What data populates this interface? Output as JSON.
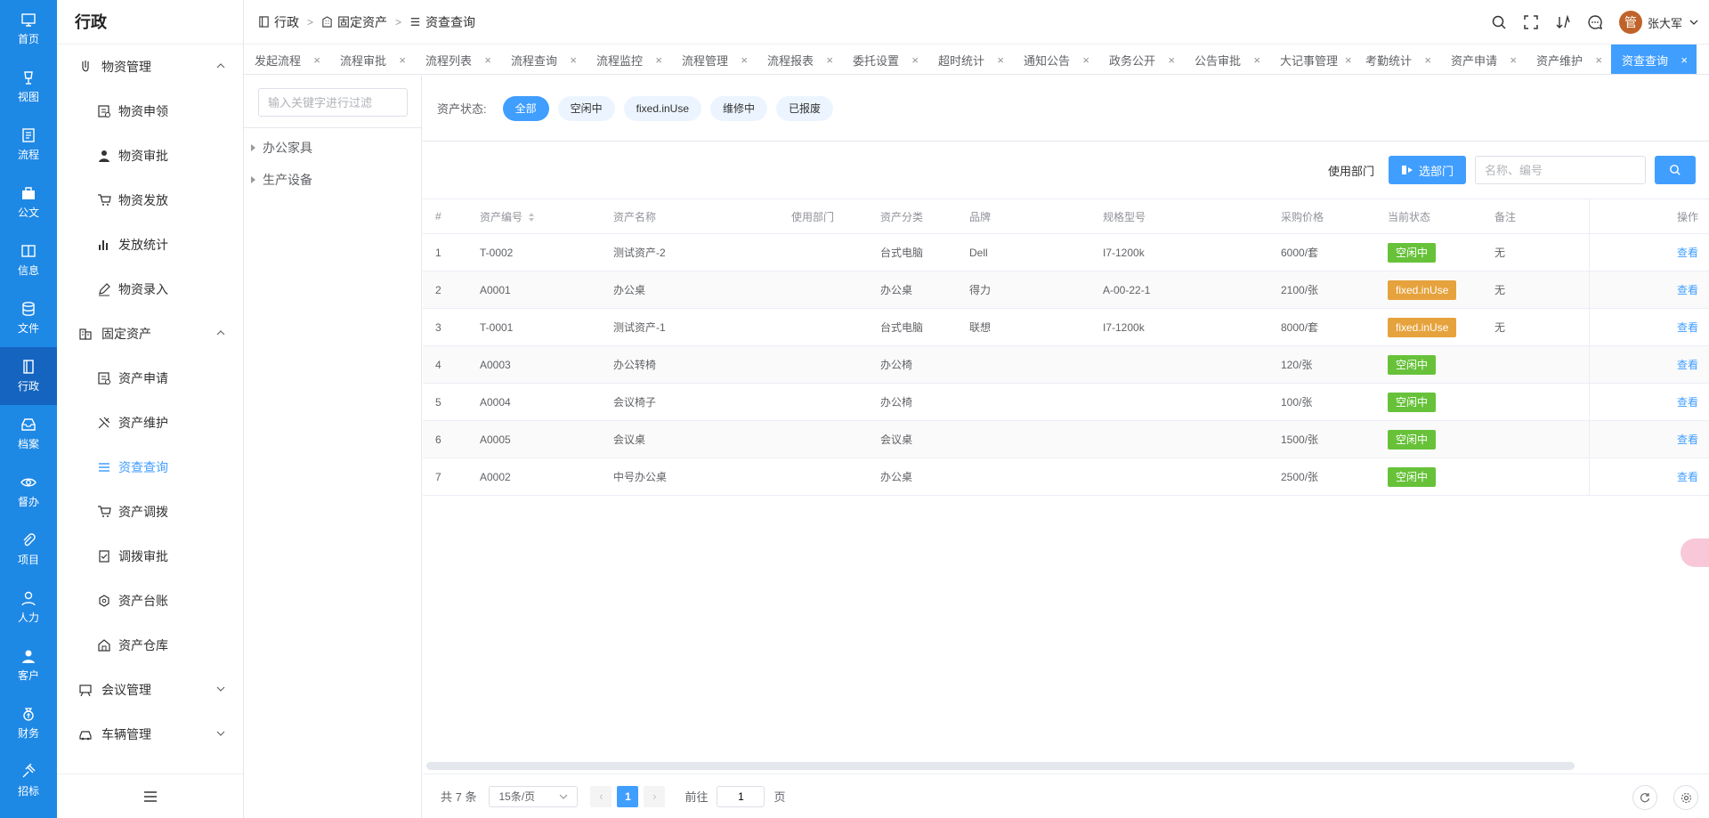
{
  "rail": [
    {
      "label": "首页",
      "icon": "monitor-icon"
    },
    {
      "label": "视图",
      "icon": "lamp-icon"
    },
    {
      "label": "流程",
      "icon": "flow-doc-icon"
    },
    {
      "label": "公文",
      "icon": "briefcase-icon"
    },
    {
      "label": "信息",
      "icon": "book-icon"
    },
    {
      "label": "文件",
      "icon": "database-icon"
    },
    {
      "label": "行政",
      "icon": "admin-icon",
      "active": true
    },
    {
      "label": "档案",
      "icon": "archive-icon"
    },
    {
      "label": "督办",
      "icon": "eye-icon"
    },
    {
      "label": "项目",
      "icon": "paperclip-icon"
    },
    {
      "label": "人力",
      "icon": "person-icon"
    },
    {
      "label": "客户",
      "icon": "customer-icon"
    },
    {
      "label": "财务",
      "icon": "money-bag-icon"
    },
    {
      "label": "招标",
      "icon": "gavel-icon"
    }
  ],
  "sidebar": {
    "title": "行政",
    "groups": [
      {
        "label": "物资管理",
        "expanded": true,
        "items": [
          "物资申领",
          "物资审批",
          "物资发放",
          "发放统计",
          "物资录入"
        ]
      },
      {
        "label": "固定资产",
        "expanded": true,
        "items": [
          "资产申请",
          "资产维护",
          "资查查询",
          "资产调拨",
          "调拨审批",
          "资产台账",
          "资产仓库"
        ]
      },
      {
        "label": "会议管理",
        "expanded": false,
        "items": []
      },
      {
        "label": "车辆管理",
        "expanded": false,
        "items": []
      }
    ]
  },
  "breadcrumb": [
    "行政",
    "固定资产",
    "资查查询"
  ],
  "user": {
    "avatar_char": "管",
    "name": "张大军"
  },
  "tabs": [
    "发起流程",
    "流程审批",
    "流程列表",
    "流程查询",
    "流程监控",
    "流程管理",
    "流程报表",
    "委托设置",
    "超时统计",
    "通知公告",
    "政务公开",
    "公告审批",
    "大记事管理",
    "考勤统计",
    "资产申请",
    "资产维护",
    "资查查询"
  ],
  "active_tab": "资查查询",
  "tree": {
    "filter_placeholder": "输入关键字进行过滤",
    "nodes": [
      "办公家具",
      "生产设备"
    ]
  },
  "status_filter": {
    "label": "资产状态:",
    "options": [
      "全部",
      "空闲中",
      "fixed.inUse",
      "维修中",
      "已报废"
    ],
    "selected": "全部"
  },
  "search": {
    "dept_label": "使用部门",
    "dept_button": "选部门",
    "placeholder": "名称、编号"
  },
  "table": {
    "headers": [
      "#",
      "资产编号",
      "资产名称",
      "使用部门",
      "资产分类",
      "品牌",
      "规格型号",
      "采购价格",
      "当前状态",
      "备注",
      "操作"
    ],
    "rows": [
      {
        "no": "1",
        "code": "T-0002",
        "name": "测试资产-2",
        "dept": "",
        "category": "台式电脑",
        "brand": "Dell",
        "model": "I7-1200k",
        "price": "6000/套",
        "status": "空闲中",
        "status_color": "green",
        "remark": "无",
        "action": "查看"
      },
      {
        "no": "2",
        "code": "A0001",
        "name": "办公桌",
        "dept": "",
        "category": "办公桌",
        "brand": "得力",
        "model": "A-00-22-1",
        "price": "2100/张",
        "status": "fixed.inUse",
        "status_color": "orange",
        "remark": "无",
        "action": "查看"
      },
      {
        "no": "3",
        "code": "T-0001",
        "name": "测试资产-1",
        "dept": "",
        "category": "台式电脑",
        "brand": "联想",
        "model": "I7-1200k",
        "price": "8000/套",
        "status": "fixed.inUse",
        "status_color": "orange",
        "remark": "无",
        "action": "查看"
      },
      {
        "no": "4",
        "code": "A0003",
        "name": "办公转椅",
        "dept": "",
        "category": "办公椅",
        "brand": "",
        "model": "",
        "price": "120/张",
        "status": "空闲中",
        "status_color": "green",
        "remark": "",
        "action": "查看"
      },
      {
        "no": "5",
        "code": "A0004",
        "name": "会议椅子",
        "dept": "",
        "category": "办公椅",
        "brand": "",
        "model": "",
        "price": "100/张",
        "status": "空闲中",
        "status_color": "green",
        "remark": "",
        "action": "查看"
      },
      {
        "no": "6",
        "code": "A0005",
        "name": "会议桌",
        "dept": "",
        "category": "会议桌",
        "brand": "",
        "model": "",
        "price": "1500/张",
        "status": "空闲中",
        "status_color": "green",
        "remark": "",
        "action": "查看"
      },
      {
        "no": "7",
        "code": "A0002",
        "name": "中号办公桌",
        "dept": "",
        "category": "办公桌",
        "brand": "",
        "model": "",
        "price": "2500/张",
        "status": "空闲中",
        "status_color": "green",
        "remark": "",
        "action": "查看"
      }
    ]
  },
  "pagination": {
    "total": "共 7 条",
    "page_size": "15条/页",
    "current_page": "1",
    "goto_label": "前往",
    "goto_value": "1",
    "page_suffix": "页"
  },
  "colors": {
    "primary": "#409eff",
    "rail": "#1e88e5",
    "success": "#67c23a",
    "warning": "#e6a23c"
  }
}
